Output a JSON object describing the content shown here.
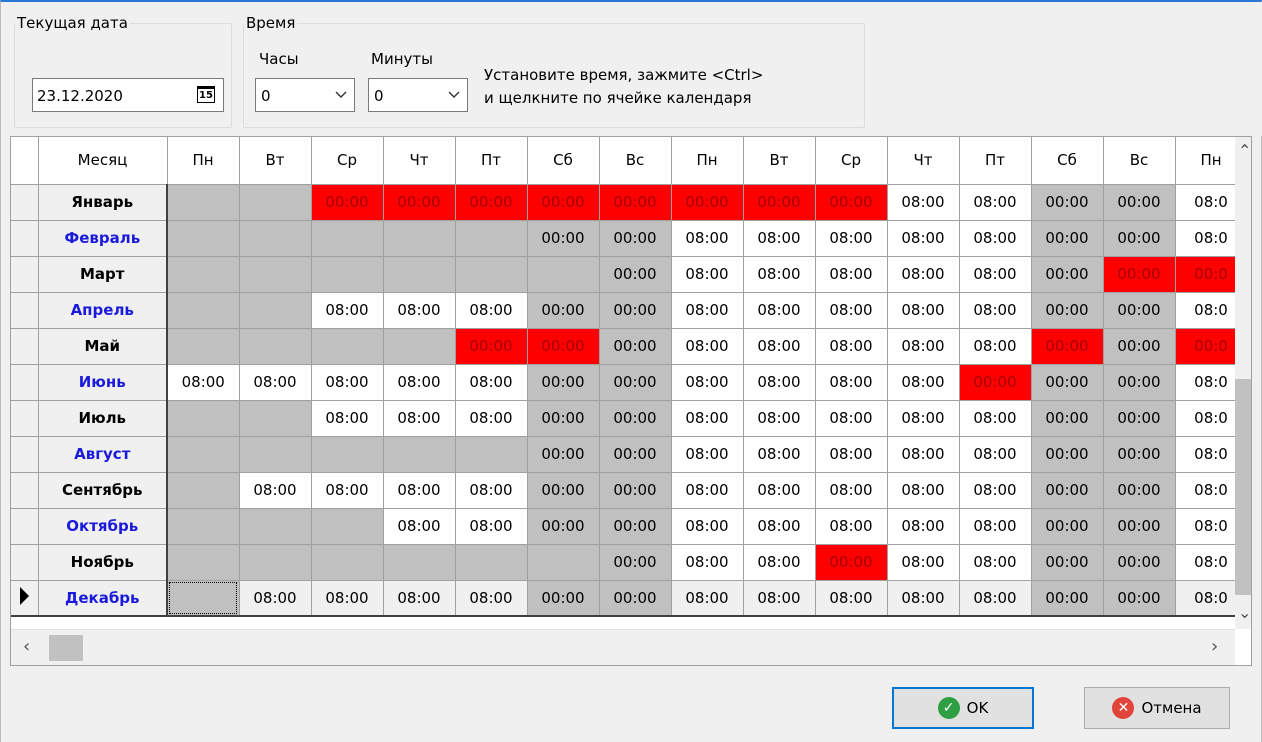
{
  "date_group": {
    "legend": "Текущая дата",
    "value": "23.12.2020",
    "icon": "calendar-icon"
  },
  "time_group": {
    "legend": "Время",
    "hours_label": "Часы",
    "hours_value": "0",
    "minutes_label": "Минуты",
    "minutes_value": "0",
    "hint_line1": "Установите время, зажмите <Ctrl>",
    "hint_line2": "и щелкните по ячейке календаря"
  },
  "grid": {
    "month_header": "Месяц",
    "day_headers": [
      "Пн",
      "Вт",
      "Ср",
      "Чт",
      "Пт",
      "Сб",
      "Вс",
      "Пн",
      "Вт",
      "Ср",
      "Чт",
      "Пт",
      "Сб",
      "Вс",
      "Пн"
    ],
    "rows": [
      {
        "month": "Январь",
        "cells": [
          "",
          "",
          "00:00",
          "00:00",
          "00:00",
          "00:00",
          "00:00",
          "00:00",
          "00:00",
          "00:00",
          "08:00",
          "08:00",
          "00:00",
          "00:00",
          "08:0"
        ]
      },
      {
        "month": "Февраль",
        "cells": [
          "",
          "",
          "",
          "",
          "",
          "00:00",
          "00:00",
          "08:00",
          "08:00",
          "08:00",
          "08:00",
          "08:00",
          "00:00",
          "00:00",
          "08:0"
        ]
      },
      {
        "month": "Март",
        "cells": [
          "",
          "",
          "",
          "",
          "",
          "",
          "00:00",
          "08:00",
          "08:00",
          "08:00",
          "08:00",
          "08:00",
          "00:00",
          "00:00",
          "00:0"
        ]
      },
      {
        "month": "Апрель",
        "cells": [
          "",
          "",
          "08:00",
          "08:00",
          "08:00",
          "00:00",
          "00:00",
          "08:00",
          "08:00",
          "08:00",
          "08:00",
          "08:00",
          "00:00",
          "00:00",
          "08:0"
        ]
      },
      {
        "month": "Май",
        "cells": [
          "",
          "",
          "",
          "",
          "00:00",
          "00:00",
          "00:00",
          "08:00",
          "08:00",
          "08:00",
          "08:00",
          "08:00",
          "00:00",
          "00:00",
          "00:0"
        ]
      },
      {
        "month": "Июнь",
        "cells": [
          "08:00",
          "08:00",
          "08:00",
          "08:00",
          "08:00",
          "00:00",
          "00:00",
          "08:00",
          "08:00",
          "08:00",
          "08:00",
          "00:00",
          "00:00",
          "00:00",
          "08:0"
        ]
      },
      {
        "month": "Июль",
        "cells": [
          "",
          "",
          "08:00",
          "08:00",
          "08:00",
          "00:00",
          "00:00",
          "08:00",
          "08:00",
          "08:00",
          "08:00",
          "08:00",
          "00:00",
          "00:00",
          "08:0"
        ]
      },
      {
        "month": "Август",
        "cells": [
          "",
          "",
          "",
          "",
          "",
          "00:00",
          "00:00",
          "08:00",
          "08:00",
          "08:00",
          "08:00",
          "08:00",
          "00:00",
          "00:00",
          "08:0"
        ]
      },
      {
        "month": "Сентябрь",
        "cells": [
          "",
          "08:00",
          "08:00",
          "08:00",
          "08:00",
          "00:00",
          "00:00",
          "08:00",
          "08:00",
          "08:00",
          "08:00",
          "08:00",
          "00:00",
          "00:00",
          "08:0"
        ]
      },
      {
        "month": "Октябрь",
        "cells": [
          "",
          "",
          "",
          "08:00",
          "08:00",
          "00:00",
          "00:00",
          "08:00",
          "08:00",
          "08:00",
          "08:00",
          "08:00",
          "00:00",
          "00:00",
          "08:0"
        ]
      },
      {
        "month": "Ноябрь",
        "cells": [
          "",
          "",
          "",
          "",
          "",
          "",
          "00:00",
          "08:00",
          "08:00",
          "00:00",
          "08:00",
          "08:00",
          "00:00",
          "00:00",
          "08:0"
        ]
      },
      {
        "month": "Декабрь",
        "cells": [
          "",
          "08:00",
          "08:00",
          "08:00",
          "08:00",
          "00:00",
          "00:00",
          "08:00",
          "08:00",
          "08:00",
          "08:00",
          "08:00",
          "00:00",
          "00:00",
          "08:0"
        ]
      }
    ],
    "holidays": {
      "0": [
        2,
        3,
        4,
        5,
        6,
        7,
        8,
        9
      ],
      "2": [
        13,
        14
      ],
      "4": [
        4,
        5,
        12,
        14
      ],
      "5": [
        11
      ],
      "10": [
        9
      ]
    },
    "weekend_cols": [
      5,
      6,
      12,
      13
    ]
  },
  "buttons": {
    "ok_label": "OK",
    "cancel_label": "Отмена"
  },
  "colors": {
    "holiday": "#ff0000",
    "weekend": "#c0c0c0",
    "empty": "#c0c0c0",
    "odd_month": "#000000",
    "even_month": "#1a1adb",
    "accent": "#0078d7"
  }
}
